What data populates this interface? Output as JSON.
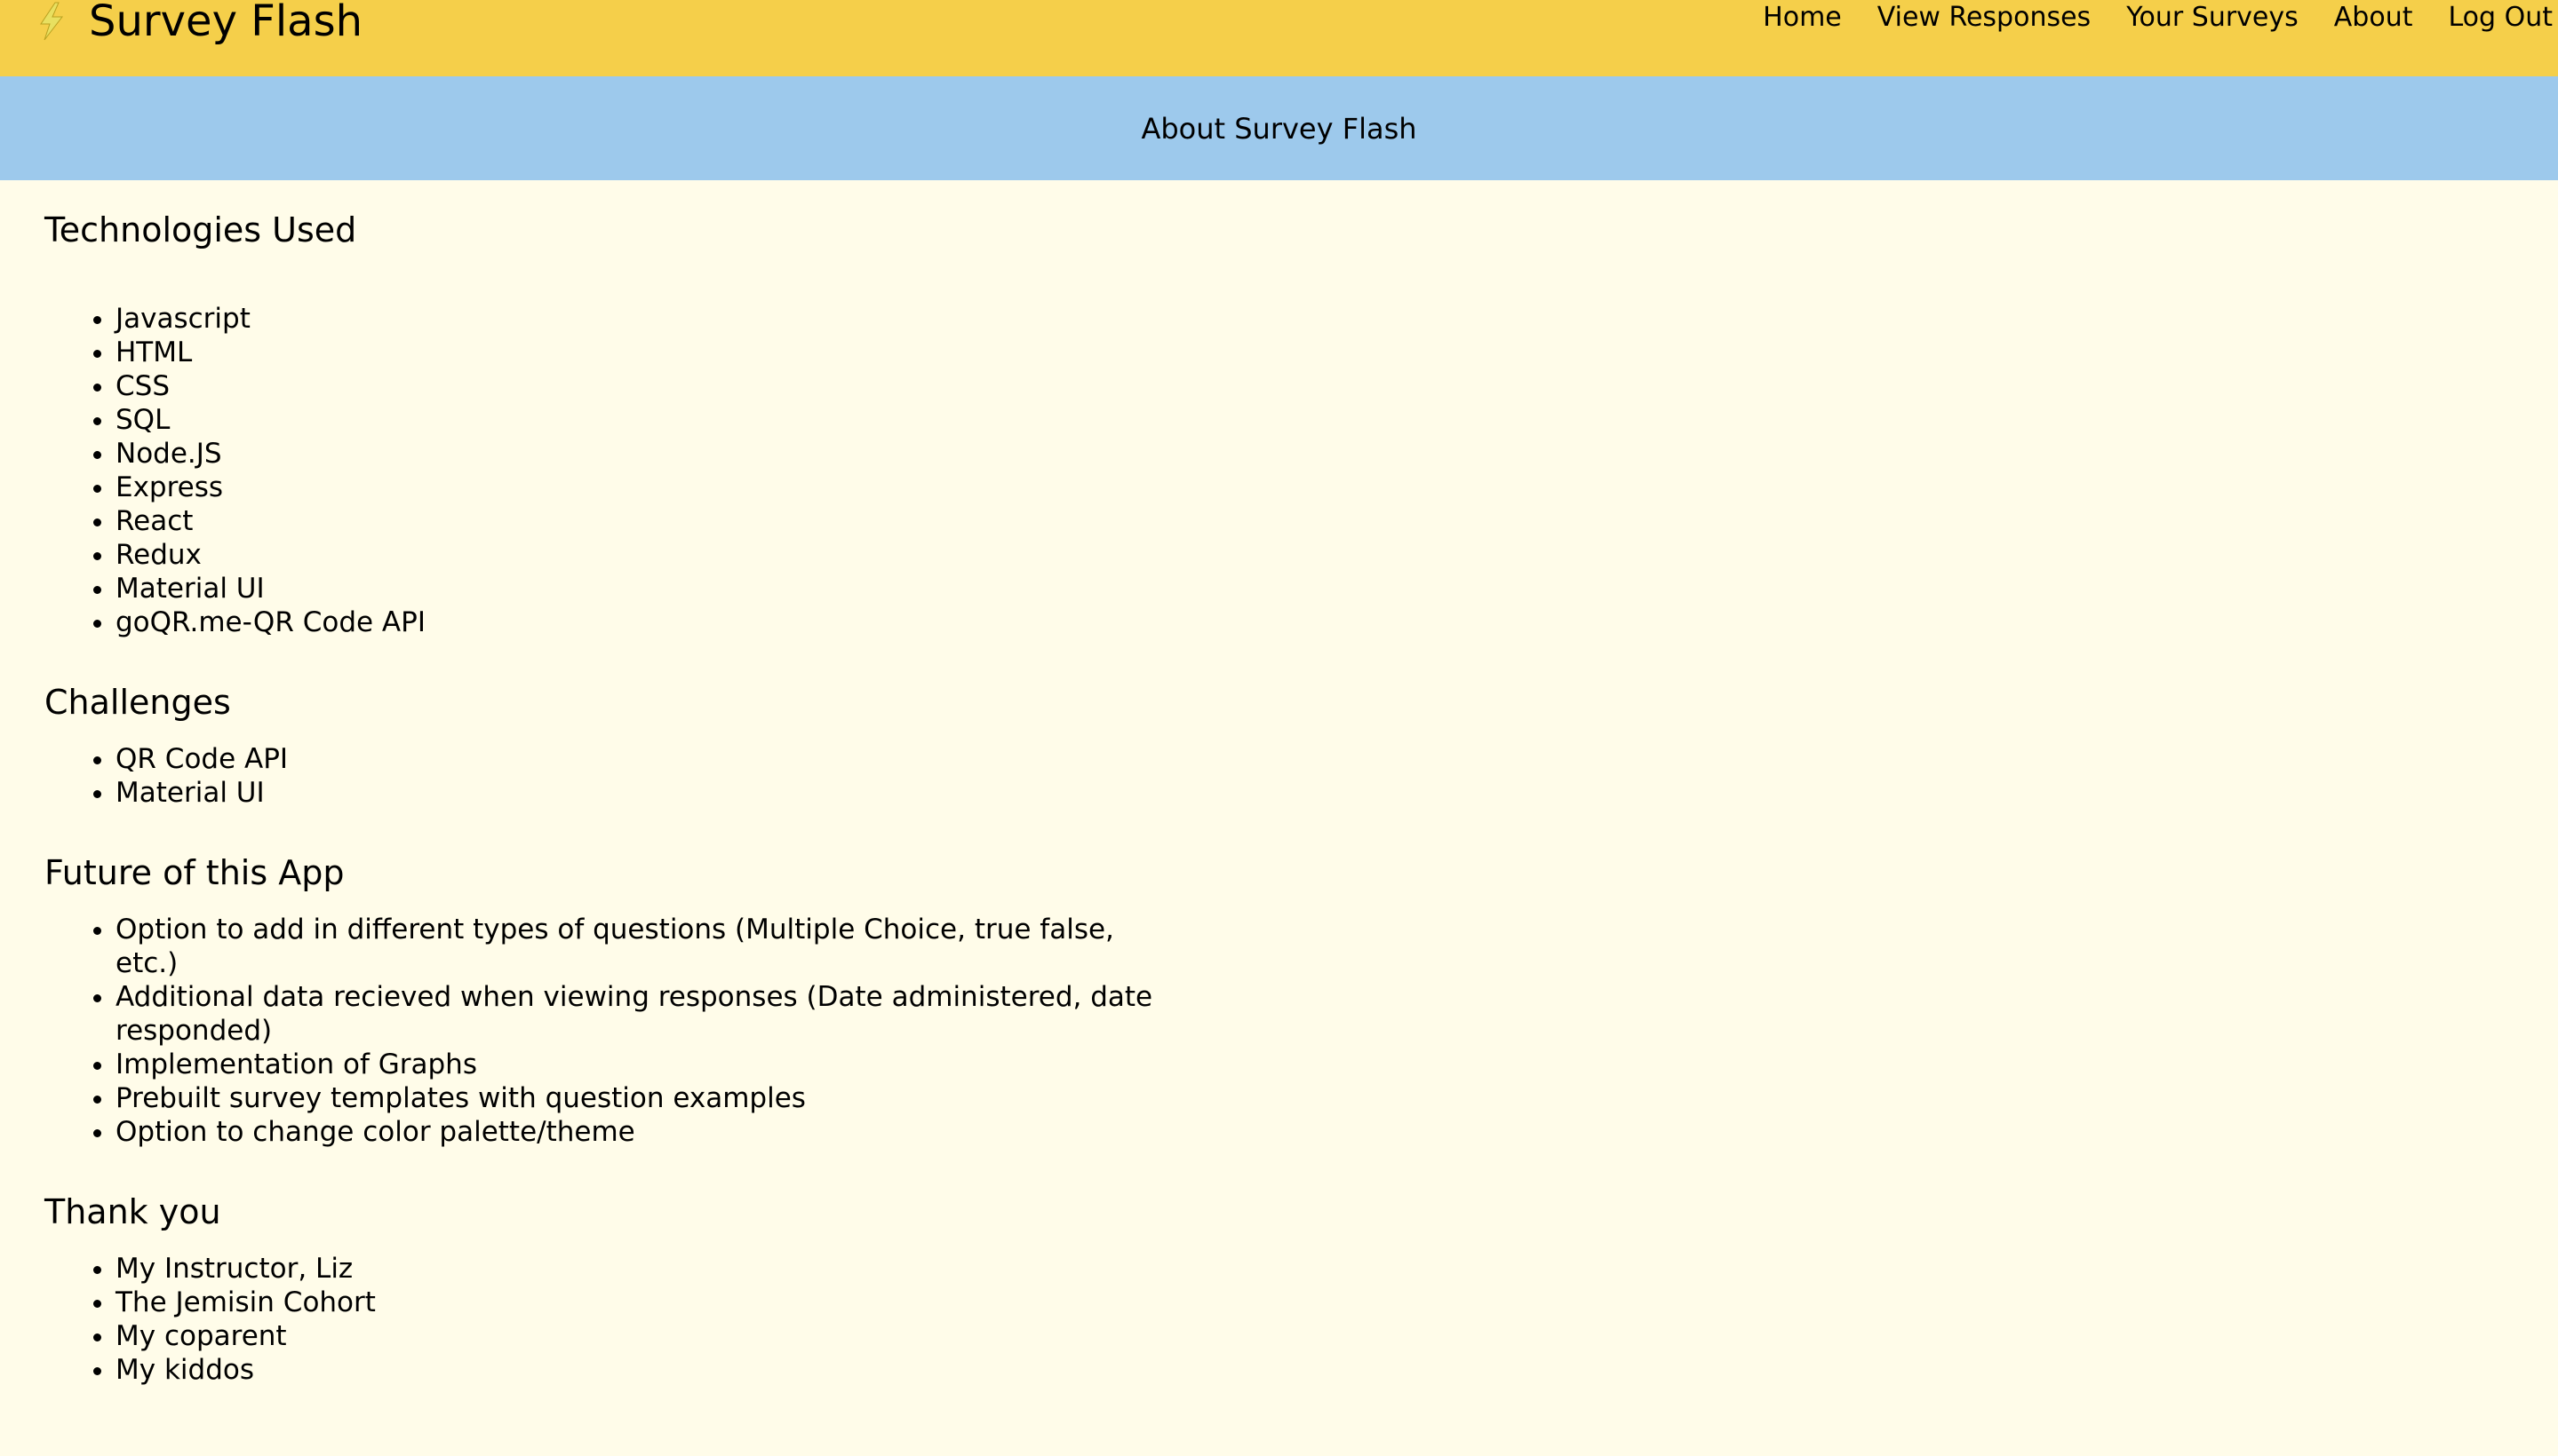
{
  "brand": {
    "title": "Survey Flash",
    "icon": "lightning-bolt-icon",
    "color": "#f5cf4a"
  },
  "nav": {
    "items": [
      "Home",
      "View Responses",
      "Your Surveys",
      "About",
      "Log Out"
    ]
  },
  "subheader": {
    "title": "About Survey Flash",
    "color": "#9dc9ec"
  },
  "sections": {
    "technologies": {
      "heading": "Technologies Used",
      "items": [
        "Javascript",
        "HTML",
        "CSS",
        "SQL",
        "Node.JS",
        "Express",
        "React",
        "Redux",
        "Material UI",
        "goQR.me-QR Code API"
      ]
    },
    "challenges": {
      "heading": "Challenges",
      "items": [
        "QR Code API",
        "Material UI"
      ]
    },
    "future": {
      "heading": "Future of this App",
      "items": [
        "Option to add in different types of questions (Multiple Choice, true false, etc.)",
        "Additional data recieved when viewing responses (Date administered, date responded)",
        "Implementation of Graphs",
        "Prebuilt survey templates with question examples",
        "Option to change color palette/theme"
      ]
    },
    "thanks": {
      "heading": "Thank you",
      "items": [
        "My Instructor, Liz",
        "The Jemisin Cohort",
        "My coparent",
        "My kiddos"
      ]
    }
  },
  "page_background": "#fffce9"
}
